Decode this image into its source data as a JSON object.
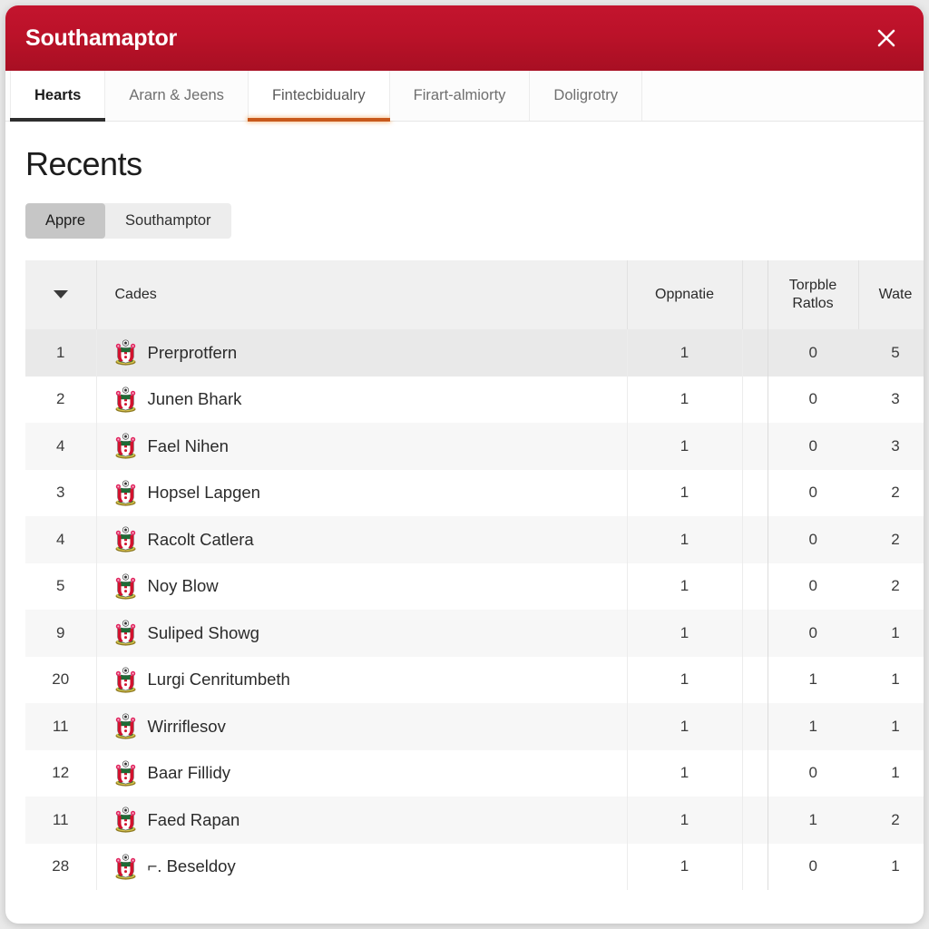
{
  "window": {
    "title": "Southamaptor",
    "close_icon": "close-icon",
    "header_color": "#c3142e"
  },
  "tabs": [
    {
      "label": "Hearts",
      "state": "active-dark",
      "underline_color": "#2e2e2e"
    },
    {
      "label": "Ararn & Jeens",
      "state": "inactive",
      "underline_color": ""
    },
    {
      "label": "Fintecbidualry",
      "state": "active-orange",
      "underline_color": "#c8591c"
    },
    {
      "label": "Firart-almiorty",
      "state": "inactive",
      "underline_color": ""
    },
    {
      "label": "Doligrotry",
      "state": "inactive",
      "underline_color": ""
    }
  ],
  "main": {
    "page_title": "Recents",
    "segmented": [
      {
        "label": "Appre",
        "selected": true
      },
      {
        "label": "Southamptor",
        "selected": false
      }
    ]
  },
  "table": {
    "sort_icon": "chevron-down-icon",
    "headers": {
      "rank": "",
      "name": "Cades",
      "opponent": "Oppnatie",
      "spacer": "",
      "ratios": "Torpble Ratlos",
      "wate": "Wate"
    },
    "rows": [
      {
        "rank": "1",
        "name": "Prerprotfern",
        "crest": "southampton-crest-icon",
        "opponent": "1",
        "ratios": "0",
        "wate": "5"
      },
      {
        "rank": "2",
        "name": "Junen Bhark",
        "crest": "southampton-crest-icon",
        "opponent": "1",
        "ratios": "0",
        "wate": "3"
      },
      {
        "rank": "4",
        "name": "Fael Nihen",
        "crest": "southampton-crest-icon",
        "opponent": "1",
        "ratios": "0",
        "wate": "3"
      },
      {
        "rank": "3",
        "name": "Hopsel Lapgen",
        "crest": "southampton-crest-icon",
        "opponent": "1",
        "ratios": "0",
        "wate": "2"
      },
      {
        "rank": "4",
        "name": "Racolt Catlera",
        "crest": "southampton-crest-icon",
        "opponent": "1",
        "ratios": "0",
        "wate": "2"
      },
      {
        "rank": "5",
        "name": "Noy Blow",
        "crest": "southampton-crest-icon",
        "opponent": "1",
        "ratios": "0",
        "wate": "2"
      },
      {
        "rank": "9",
        "name": "Suliped Showg",
        "crest": "southampton-crest-icon",
        "opponent": "1",
        "ratios": "0",
        "wate": "1"
      },
      {
        "rank": "20",
        "name": "Lurgi Cenritumbeth",
        "crest": "southampton-crest-icon",
        "opponent": "1",
        "ratios": "1",
        "wate": "1"
      },
      {
        "rank": "11",
        "name": "Wirriflesov",
        "crest": "southampton-crest-icon",
        "opponent": "1",
        "ratios": "1",
        "wate": "1"
      },
      {
        "rank": "12",
        "name": "Baar Fillidy",
        "crest": "southampton-crest-icon",
        "opponent": "1",
        "ratios": "0",
        "wate": "1"
      },
      {
        "rank": "11",
        "name": "Faed Rapan",
        "crest": "southampton-crest-icon",
        "opponent": "1",
        "ratios": "1",
        "wate": "2"
      },
      {
        "rank": "28",
        "name": "⌐. Beseldoy",
        "crest": "southampton-crest-icon",
        "opponent": "1",
        "ratios": "0",
        "wate": "1"
      }
    ]
  }
}
